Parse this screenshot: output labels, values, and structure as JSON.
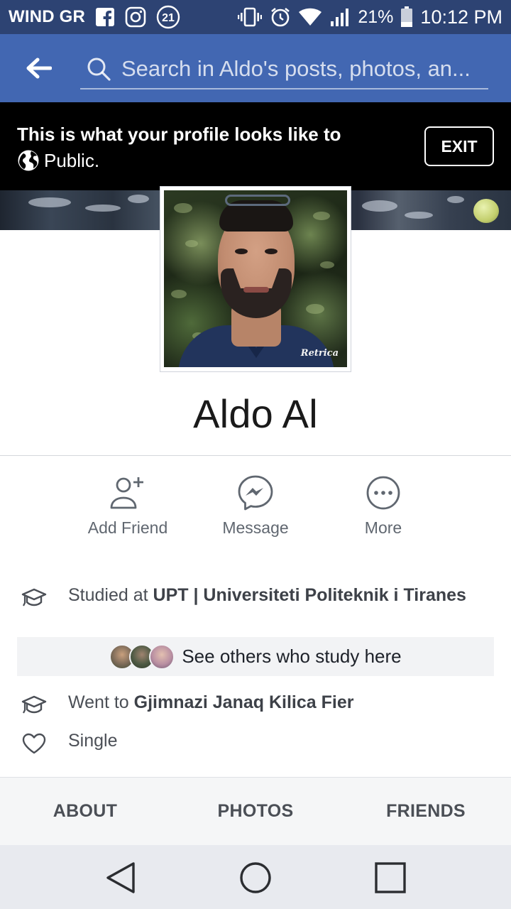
{
  "status_bar": {
    "carrier": "WIND GR",
    "notification_count": "21",
    "battery": "21%",
    "time": "10:12 PM"
  },
  "topnav": {
    "search_placeholder": "Search in Aldo's posts, photos, an..."
  },
  "banner": {
    "line1": "This is what your profile looks like to",
    "audience": "Public.",
    "exit_label": "EXIT"
  },
  "profile": {
    "name": "Aldo Al",
    "photo_watermark": "Retrica"
  },
  "actions": {
    "add_friend": "Add Friend",
    "message": "Message",
    "more": "More"
  },
  "intro": {
    "studied_prefix": "Studied at ",
    "studied_school": "UPT | Universiteti Politeknik i Tiranes",
    "see_others": "See others who study here",
    "went_prefix": "Went to ",
    "went_school": "Gjimnazi Janaq Kilica Fier",
    "relationship": "Single"
  },
  "tabs": [
    "ABOUT",
    "PHOTOS",
    "FRIENDS"
  ],
  "colors": {
    "status_bar": "#2d4373",
    "facebook_blue": "#4267b2",
    "banner_bg": "#000000",
    "icon_gray": "#606770"
  },
  "icons": {
    "back": "arrow-left-icon",
    "search": "search-icon",
    "globe": "globe-icon",
    "add_friend": "add-friend-icon",
    "message": "messenger-icon",
    "more": "more-dots-icon",
    "education": "graduation-cap-icon",
    "relationship": "heart-icon"
  }
}
